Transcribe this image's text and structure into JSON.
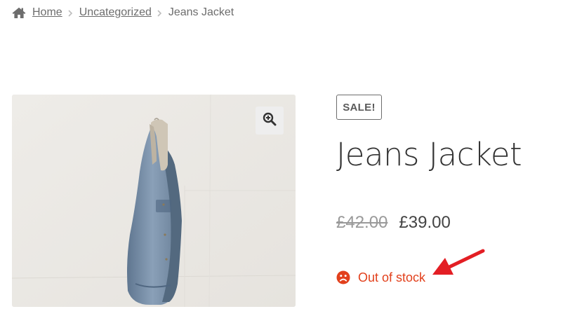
{
  "breadcrumb": {
    "home_icon": "home-icon",
    "items": [
      {
        "label": "Home",
        "link": true
      },
      {
        "label": "Uncategorized",
        "link": true
      },
      {
        "label": "Jeans Jacket",
        "link": false
      }
    ],
    "separator_icon": "chevron-right-icon"
  },
  "product": {
    "image_alt": "denim jacket hanging on white wall",
    "zoom_icon": "zoom-in-icon",
    "sale_badge": "SALE!",
    "title": "Jeans Jacket",
    "regular_price": "£42.00",
    "sale_price": "£39.00",
    "stock_status": "Out of stock",
    "stock_icon": "sad-face-icon"
  },
  "annotation": {
    "type": "arrow",
    "color": "#e31e24",
    "points_to": "stock-status"
  },
  "colors": {
    "text": "#6d6d6d",
    "title": "#333333",
    "out_of_stock": "#e2401c",
    "arrow": "#e31e24"
  }
}
